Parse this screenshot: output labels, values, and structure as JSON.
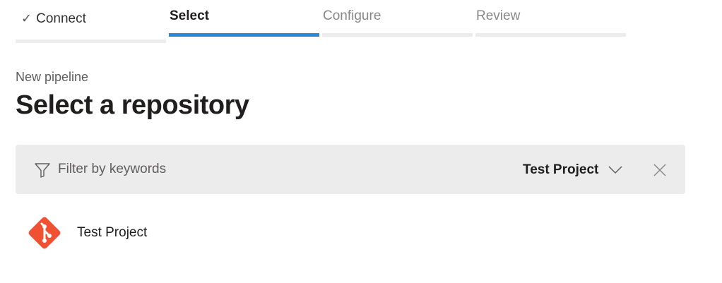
{
  "wizard": {
    "steps": [
      {
        "label": "Connect",
        "state": "completed"
      },
      {
        "label": "Select",
        "state": "active"
      },
      {
        "label": "Configure",
        "state": "pending"
      },
      {
        "label": "Review",
        "state": "pending"
      }
    ],
    "check_glyph": "✓"
  },
  "header": {
    "subtitle": "New pipeline",
    "title": "Select a repository"
  },
  "filter": {
    "placeholder": "Filter by keywords",
    "value": "",
    "project_selected": "Test Project",
    "icons": {
      "filter": "filter-icon",
      "dropdown": "chevron-down-icon",
      "clear": "close-icon"
    }
  },
  "repositories": [
    {
      "name": "Test Project",
      "icon": "git-repo-icon"
    }
  ],
  "colors": {
    "active_step": "#2b88d8",
    "inactive_step": "#ececec",
    "filter_bg": "#ececec",
    "git_orange": "#f05133"
  }
}
